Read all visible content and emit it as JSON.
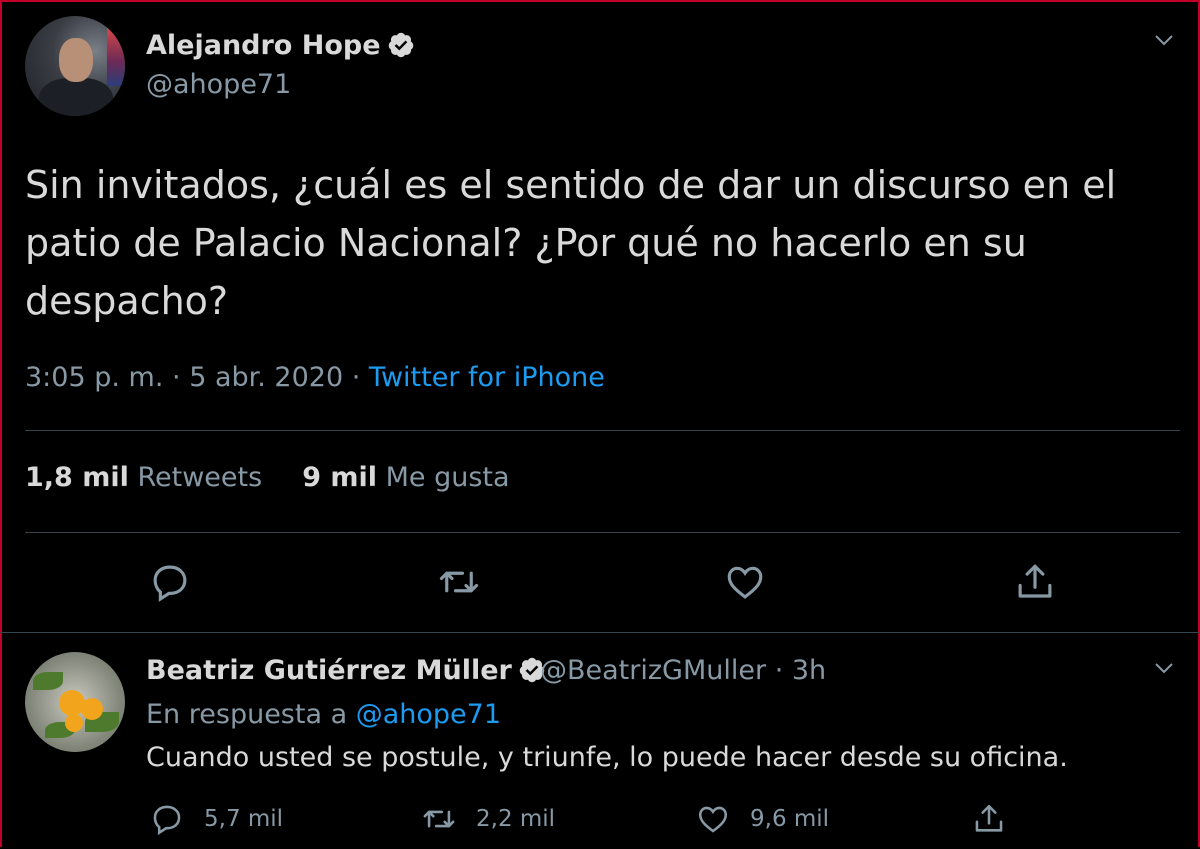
{
  "tweet": {
    "author_name": "Alejandro Hope",
    "author_handle": "@ahope71",
    "text": "Sin invitados, ¿cuál es el sentido de dar un discurso en el patio de Palacio Nacional? ¿Por qué no hacerlo en su despacho?",
    "time": "3:05 p. m.",
    "date": "5 abr. 2020",
    "source": "Twitter for iPhone",
    "retweets_count": "1,8 mil",
    "retweets_label": "Retweets",
    "likes_count": "9 mil",
    "likes_label": "Me gusta"
  },
  "reply": {
    "author_name": "Beatriz Gutiérrez Müller",
    "author_handle": "@BeatrizGMuller",
    "age": "3h",
    "in_reply_label": "En respuesta a",
    "in_reply_handle": "@ahope71",
    "text": "Cuando usted se postule, y triunfe, lo puede hacer desde su oficina.",
    "replies_count": "5,7 mil",
    "retweets_count": "2,2 mil",
    "likes_count": "9,6 mil"
  },
  "icons": {
    "verified": "verified-badge-icon",
    "menu": "chevron-down-icon",
    "reply": "reply-icon",
    "retweet": "retweet-icon",
    "like": "heart-icon",
    "share": "share-icon"
  },
  "colors": {
    "background": "#000000",
    "text": "#d9d9d9",
    "secondary": "#8899a6",
    "link": "#1d9bf0",
    "frame_border": "#c0002a"
  }
}
